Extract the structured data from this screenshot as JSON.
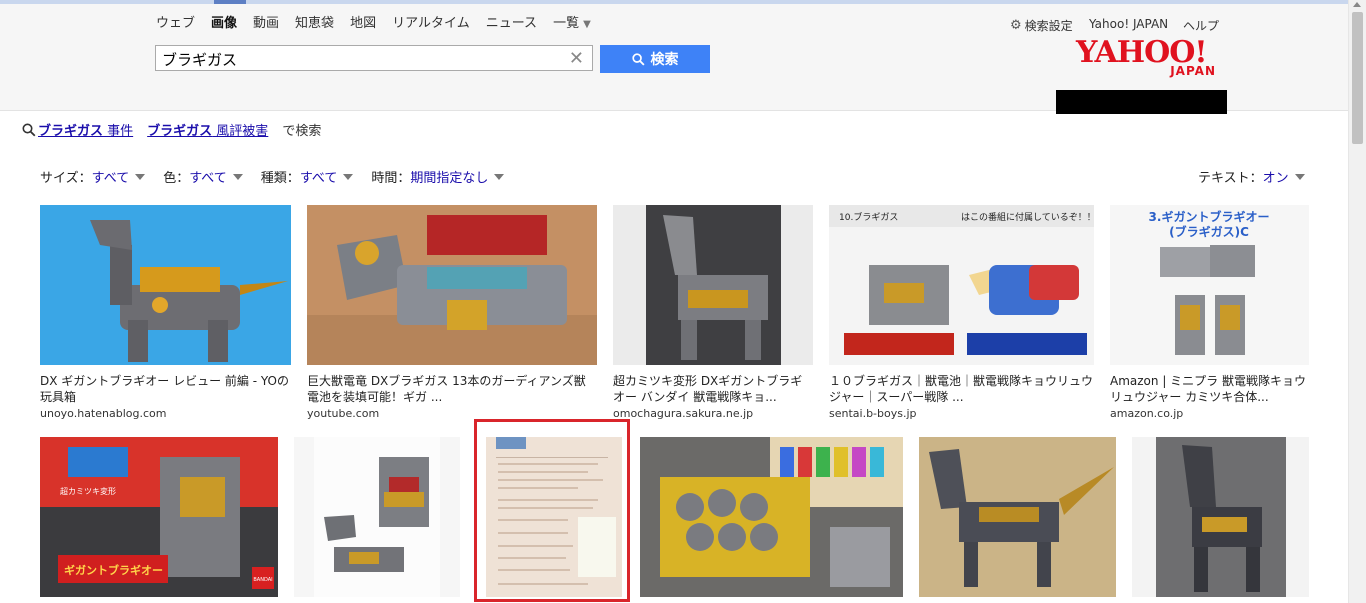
{
  "nav": {
    "tabs": [
      "ウェブ",
      "画像",
      "動画",
      "知恵袋",
      "地図",
      "リアルタイム",
      "ニュース",
      "一覧"
    ],
    "active_tab": "画像"
  },
  "search": {
    "value": "ブラギガス",
    "button_label": "検索"
  },
  "header_links": {
    "settings": "検索設定",
    "yahoo_japan": "Yahoo! JAPAN",
    "help": "ヘルプ"
  },
  "logo": {
    "main": "YAHOO!",
    "sub": "JAPAN"
  },
  "related": {
    "items": [
      {
        "kw": "ブラギガス",
        "rest": " 事件"
      },
      {
        "kw": "ブラギガス",
        "rest": " 風評被害"
      }
    ],
    "suffix": "で検索"
  },
  "filters": [
    {
      "label": "サイズ：",
      "value": "すべて"
    },
    {
      "label": "色：",
      "value": "すべて"
    },
    {
      "label": "種類：",
      "value": "すべて"
    },
    {
      "label": "時間：",
      "value": "期間指定なし"
    }
  ],
  "text_option": {
    "label": "テキスト：",
    "value": "オン"
  },
  "results_row1": [
    {
      "title": "DX ギガントブラギオー レビュー 前編 - YOの玩具箱",
      "domain": "unoyo.hatenablog.com"
    },
    {
      "title": "巨大獣電竜 DXブラギガス 13本のガーディアンズ獣電池を装填可能！ギガ ...",
      "domain": "youtube.com"
    },
    {
      "title": "超カミツキ変形 DXギガントブラギオー バンダイ 獣電戦隊キョ...",
      "domain": "omochagura.sakura.ne.jp"
    },
    {
      "title": "１０ブラギガス｜獣電池｜獣電戦隊キョウリュウジャー｜スーパー戦隊 ...",
      "domain": "sentai.b-boys.jp"
    },
    {
      "title": "Amazon | ミニプラ 獣電戦隊キョウリュウジャー カミツキ合体...",
      "domain": "amazon.co.jp"
    }
  ],
  "thumb_texts": {
    "t4_header": "10.ブラギガス",
    "t4_header2": "はこの番組に付属しているぞ！！",
    "t5_title": "3.ギガントブラギオー",
    "t5_sub": "(ブラギガス)C",
    "r2_box_text": "超カミツキ変形",
    "r2_box_title": "ギガントブラギオー",
    "r2_brand": "BANDAI"
  },
  "colors": {
    "accent": "#3e82f7",
    "highlight": "#d9252b",
    "logo": "#e0121f"
  }
}
